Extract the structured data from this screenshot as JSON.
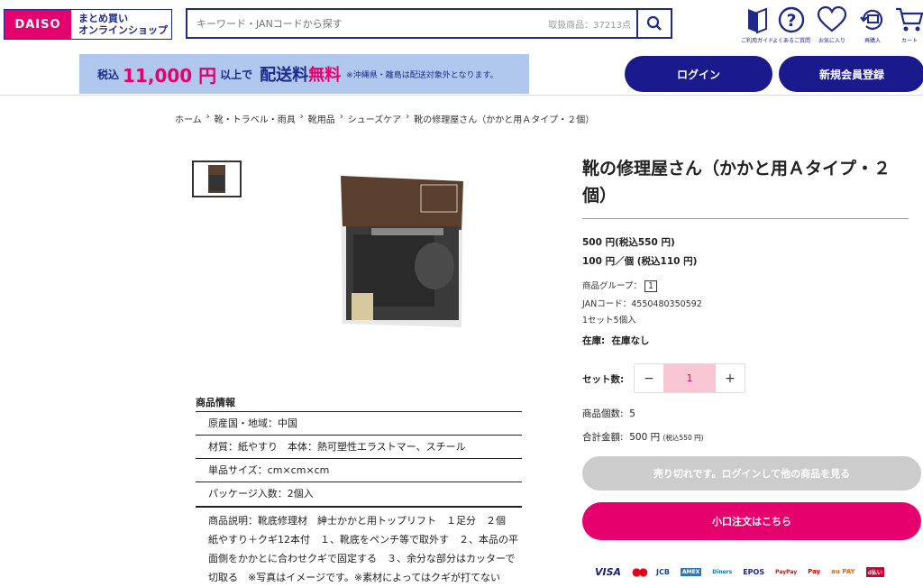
{
  "header": {
    "logo_brand": "DAISO",
    "logo_line1": "まとめ買い",
    "logo_line2": "オンラインショップ",
    "search_placeholder": "キーワード・JANコードから探す",
    "search_count": "取扱商品：37213点",
    "icons": [
      {
        "icon": "guide-icon",
        "label": "ご利用ガイド"
      },
      {
        "icon": "question-icon",
        "label": "よくあるご質問"
      },
      {
        "icon": "heart-icon",
        "label": "お気に入り"
      },
      {
        "icon": "reorder-icon",
        "label": "再購入"
      },
      {
        "icon": "cart-icon",
        "label": "カート"
      }
    ]
  },
  "banner": {
    "prefix": "税込",
    "amount": "11,000 円",
    "suffix": "以上で",
    "free1": "配送料",
    "free2": "無料",
    "note": "※沖縄県・離島は配送対象外となります。"
  },
  "auth": {
    "login": "ログイン",
    "register": "新規会員登録"
  },
  "breadcrumb": [
    "ホーム",
    "›",
    "靴・トラベル・雨具",
    "›",
    "靴用品",
    "›",
    "シューズケア",
    "›",
    "靴の修理屋さん（かかと用Ａタイプ・２個）"
  ],
  "product": {
    "title": "靴の修理屋さん（かかと用Ａタイプ・２個）",
    "price": "500 円(税込550 円)",
    "unit_price": "100 円／個 (税込110 円)",
    "group_label": "商品グループ：",
    "group_value": "1",
    "jan": "JANコード：4550480350592",
    "set_info": "1セット5個入",
    "stock_label": "在庫:",
    "stock_value": "在庫なし",
    "set_count_label": "セット数:",
    "qty_minus": "−",
    "qty_value": "1",
    "qty_plus": "+",
    "item_count_label": "商品個数:",
    "item_count_value": "5",
    "total_label": "合計金額:",
    "total_value": "500 円",
    "total_tax": "(税込550 円)",
    "soldout_button": "売り切れです。ログインして他の商品を見る",
    "small_order_button": "小口注文はこちら"
  },
  "payments": [
    "VISA",
    "●●",
    "JCB",
    "AMEX",
    "Diners",
    "EPOS",
    "PayPay",
    "Pay",
    "au PAY",
    "d払い"
  ],
  "info": {
    "heading": "商品情報",
    "rows": [
      "原産国・地域：中国",
      "材質：紙やすり　本体：熱可塑性エラストマー、スチール",
      "単品サイズ：cm×cm×cm",
      "パッケージ入数：2個入"
    ],
    "description": "商品説明：靴底修理材　紳士かかと用トップリフト　１足分　２個　紙やすり＋クギ12本付　１、靴底をペンチ等で取外す　２、本品の平面側をかかとに合わせクギで固定する　３、余分な部分はカッターで切取る　※写真はイメージです。※素材によってはクギが打てない"
  },
  "colors": {
    "navy": "#1a1a8c",
    "pink": "#e5006e",
    "banner": "#b0c8ee"
  }
}
